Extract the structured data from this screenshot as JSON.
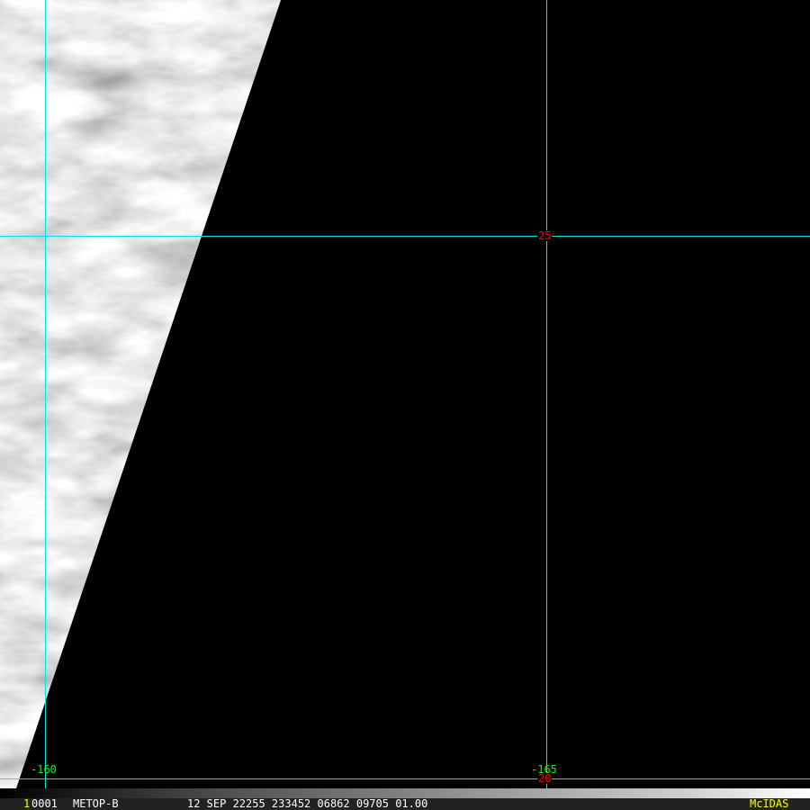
{
  "grid_labels": {
    "lon_left": "-160",
    "lon_right": "-165",
    "lat_upper": "25",
    "lat_lower": "20"
  },
  "status": {
    "frame_marker": "1",
    "frame_id": "0001",
    "satellite": "METOP-B",
    "info": "12 SEP 22255 233452 06862 09705 01.00",
    "brand": "McIDAS"
  },
  "colors": {
    "grid": "#00e5e5",
    "lon_label": "#00ff00",
    "lat_label": "#ff0000",
    "brand": "#ffff00"
  }
}
